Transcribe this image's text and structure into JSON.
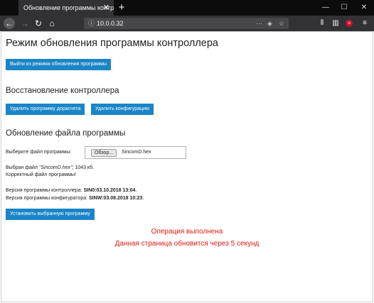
{
  "browser": {
    "tab_title": "Обновление программы контролера",
    "tab_close": "✕",
    "new_tab": "+",
    "url": "10.0.0.32",
    "win_minimize": "—",
    "win_maximize": "☐",
    "win_close": "✕",
    "icons": [
      "back-arrow-icon",
      "forward-arrow-icon",
      "reload-icon",
      "home-icon",
      "info-icon",
      "pocket-icon",
      "bookmark-star-icon",
      "library-icon",
      "sidebar-icon",
      "ublock-icon",
      "menu-icon"
    ]
  },
  "page": {
    "title": "Режим обновления программы контроллера",
    "exit_button": "Выйти из режима обновления программы",
    "restore": {
      "heading": "Восстановление контроллера",
      "delete_program_button": "Удалить программу дорасчета",
      "delete_config_button": "Удалить конфигурацию"
    },
    "update": {
      "heading": "Обновление файла программы",
      "file_label": "Выберите файл программы:",
      "browse_button": "Обзор...",
      "file_name": "SincomD.hex",
      "selected_prefix": "Выбран файл ",
      "selected_file": "\"SincomD.hex\"",
      "selected_size": "; 1043 кб.",
      "valid_text": "Корректный файл программы!",
      "controller_version_label": "Версия программы контроллера: ",
      "controller_version": "SIN0:03.10.2018 13:04",
      "configurator_version_label": "Версия программы конфигуратора: ",
      "configurator_version": "SINW:03.08.2018 10:23",
      "install_button": "Установить выбранную программу"
    },
    "status": {
      "line1": "Операция выполнена",
      "line2": "Данная страница обновится через 5 секунд"
    },
    "colors": {
      "button": "#1a85c7",
      "status_text": "#e8190f",
      "tab_bar": "#0c0c0d",
      "toolbar": "#323234"
    }
  }
}
